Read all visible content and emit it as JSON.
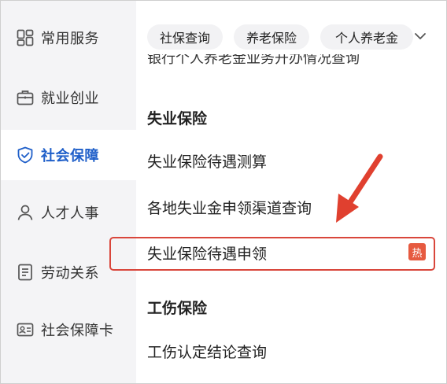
{
  "sidebar": {
    "items": [
      {
        "label": "常用服务",
        "icon": "grid-apps-icon"
      },
      {
        "label": "就业创业",
        "icon": "briefcase-icon"
      },
      {
        "label": "社会保障",
        "icon": "shield-check-icon",
        "active": true
      },
      {
        "label": "人才人事",
        "icon": "user-icon"
      },
      {
        "label": "劳动关系",
        "icon": "document-icon"
      },
      {
        "label": "社会保障卡",
        "icon": "id-card-icon"
      }
    ]
  },
  "tabs": [
    {
      "label": "社保查询"
    },
    {
      "label": "养老保险"
    },
    {
      "label": "个人养老金"
    }
  ],
  "content": {
    "clipped_text": "银行个人养老金业务开办情况查询",
    "section_unemployment": {
      "title": "失业保险",
      "items": [
        {
          "label": "失业保险待遇测算"
        },
        {
          "label": "各地失业金申领渠道查询"
        },
        {
          "label": "失业保险待遇申领",
          "badge": "热"
        }
      ]
    },
    "section_injury": {
      "title": "工伤保险",
      "items": [
        {
          "label": "工伤认定结论查询"
        }
      ]
    }
  },
  "colors": {
    "accent": "#1f5fc9",
    "highlight": "#d9463b",
    "badge": "#e65a40",
    "sidebar_bg": "#f4f4f6"
  }
}
